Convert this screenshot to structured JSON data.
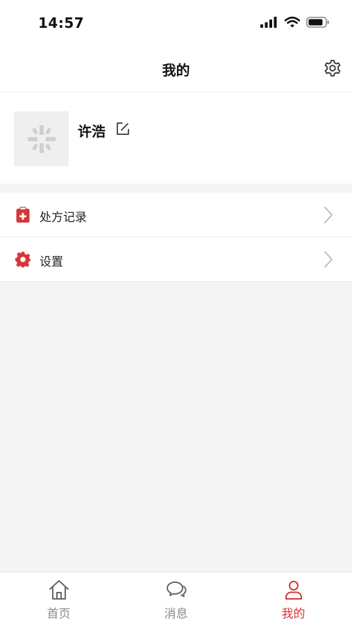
{
  "status_bar": {
    "time": "14:57"
  },
  "header": {
    "title": "我的",
    "settings_icon": "gear-icon"
  },
  "profile": {
    "name": "许浩",
    "avatar_icon": "logo-placeholder-icon",
    "edit_icon": "edit-icon"
  },
  "menu": {
    "items": [
      {
        "label": "处方记录",
        "icon": "prescription-icon"
      },
      {
        "label": "设置",
        "icon": "gear-icon"
      }
    ]
  },
  "tabbar": {
    "items": [
      {
        "label": "首页",
        "icon": "home-icon",
        "active": false
      },
      {
        "label": "消息",
        "icon": "chat-icon",
        "active": false
      },
      {
        "label": "我的",
        "icon": "user-icon",
        "active": true
      }
    ]
  },
  "colors": {
    "accent": "#d4373a",
    "background": "#f4f4f4",
    "tab_inactive": "#8a8a8a"
  }
}
